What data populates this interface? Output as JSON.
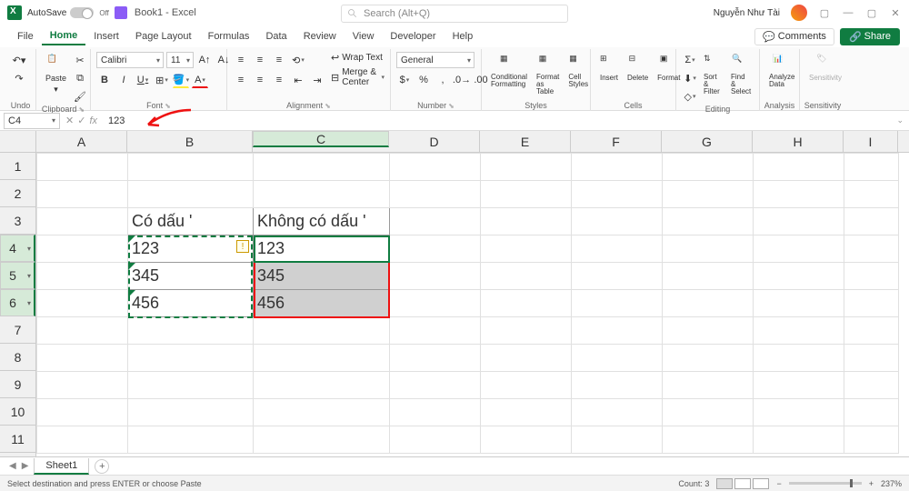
{
  "title_bar": {
    "autosave_label": "AutoSave",
    "autosave_state": "Off",
    "doc_name": "Book1 - Excel",
    "search_placeholder": "Search (Alt+Q)",
    "user_name": "Nguyễn Như Tài"
  },
  "tabs": {
    "file": "File",
    "home": "Home",
    "insert": "Insert",
    "page_layout": "Page Layout",
    "formulas": "Formulas",
    "data": "Data",
    "review": "Review",
    "view": "View",
    "developer": "Developer",
    "help": "Help",
    "comments": "Comments",
    "share": "Share"
  },
  "ribbon": {
    "undo": "Undo",
    "clipboard": "Clipboard",
    "paste": "Paste",
    "font": "Font",
    "font_name": "Calibri",
    "font_size": "11",
    "alignment": "Alignment",
    "wrap_text": "Wrap Text",
    "merge_center": "Merge & Center",
    "number": "Number",
    "number_format": "General",
    "styles": "Styles",
    "cond_fmt": "Conditional Formatting",
    "fmt_table": "Format as Table",
    "cell_styles": "Cell Styles",
    "cells": "Cells",
    "insert_c": "Insert",
    "delete_c": "Delete",
    "format_c": "Format",
    "editing": "Editing",
    "sort_filter": "Sort & Filter",
    "find_select": "Find & Select",
    "analysis": "Analysis",
    "analyze": "Analyze Data",
    "sensitivity": "Sensitivity",
    "sensitivity_btn": "Sensitivity"
  },
  "formula_bar": {
    "name_box": "C4",
    "formula": "123"
  },
  "columns": [
    "A",
    "B",
    "C",
    "D",
    "E",
    "F",
    "G",
    "H",
    "I"
  ],
  "rows": [
    "1",
    "2",
    "3",
    "4",
    "5",
    "6",
    "7",
    "8",
    "9",
    "10",
    "11"
  ],
  "grid": {
    "B3": "Có dấu '",
    "C3": "Không có dấu '",
    "B4": "123",
    "B5": "345",
    "B6": "456",
    "C4": "123",
    "C5": "345",
    "C6": "456"
  },
  "sheet_tabs": {
    "sheet1": "Sheet1"
  },
  "status": {
    "message": "Select destination and press ENTER or choose Paste",
    "count_label": "Count: 3",
    "zoom": "237%"
  }
}
